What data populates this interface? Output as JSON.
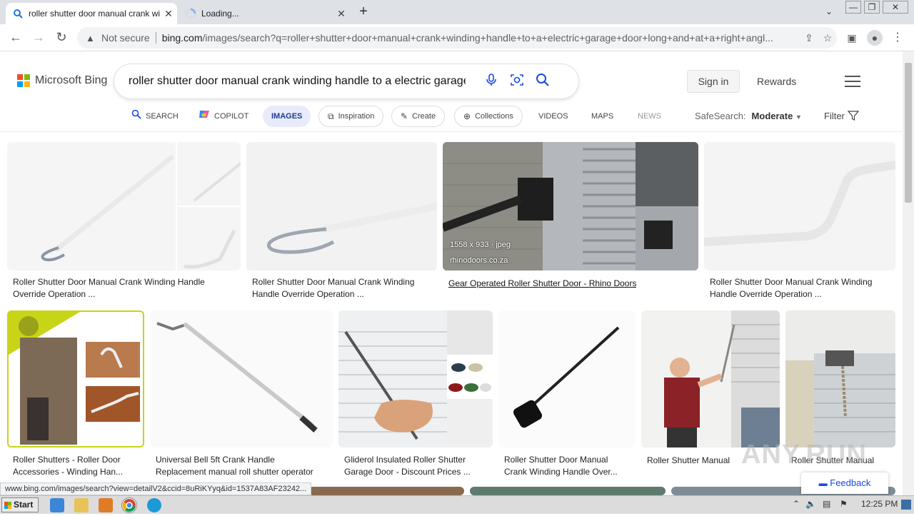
{
  "browser": {
    "tabs": [
      {
        "title": "roller shutter door manual crank winding handle",
        "close": "✕"
      },
      {
        "title": "Loading...",
        "close": "✕"
      }
    ],
    "new_tab": "+",
    "controls": {
      "dropdown": "⌄",
      "minimize": "—",
      "restore": "❐",
      "close": "✕"
    },
    "nav": {
      "back": "←",
      "forward": "→",
      "reload": "↻"
    },
    "omnibox": {
      "security": "Not secure",
      "url_host": "bing.com",
      "url_path": "/images/search?q=roller+shutter+door+manual+crank+winding+handle+to+a+electric+garage+door+long+and+at+a+right+angl..."
    }
  },
  "bing": {
    "brand": "Microsoft Bing",
    "brand_colors": [
      "#f25022",
      "#7fba00",
      "#00a4ef",
      "#ffb900"
    ],
    "query": "roller shutter door manual crank winding handle to a electric garage d",
    "sign_in": "Sign in",
    "rewards": "Rewards",
    "nav": {
      "search": "SEARCH",
      "copilot": "COPILOT",
      "images": "IMAGES",
      "inspiration": "Inspiration",
      "create": "Create",
      "collections": "Collections",
      "videos": "VIDEOS",
      "maps": "MAPS",
      "news": "NEWS"
    },
    "safesearch_label": "SafeSearch:",
    "safesearch_value": "Moderate",
    "filter": "Filter",
    "results_row1": [
      {
        "caption1": "Roller Shutter Door Manual Crank Winding Handle",
        "caption2": "Override Operation ..."
      },
      {
        "caption1": "Roller Shutter Door Manual Crank Winding",
        "caption2": "Handle Override Operation ..."
      },
      {
        "caption1": "Gear Operated Roller Shutter Door - Rhino Doors",
        "caption2": "",
        "meta": "1558 x 933 · jpeg",
        "source": "rhinodoors.co.za"
      },
      {
        "caption1": "Roller Shutter Door Manual Crank Winding",
        "caption2": "Handle Override Operation ..."
      }
    ],
    "results_row2": [
      {
        "caption1": "Roller Shutters - Roller Door",
        "caption2": "Accessories - Winding Han..."
      },
      {
        "caption1": "Universal Bell 5ft Crank Handle",
        "caption2": "Replacement manual roll shutter operator"
      },
      {
        "caption1": "Gliderol Insulated Roller Shutter",
        "caption2": "Garage Door - Discount Prices ..."
      },
      {
        "caption1": "Roller Shutter Door Manual",
        "caption2": "Crank Winding Handle Over..."
      },
      {
        "caption1": "Roller Shutter Manual",
        "caption2": ""
      },
      {
        "caption1": "Roller Shutter Manual",
        "caption2": ""
      }
    ],
    "feedback": "Feedback"
  },
  "status_url": "www.bing.com/images/search?view=detailV2&ccid=8uRiKYyq&id=1537A83AF23242...",
  "watermark": "ANY.RUN",
  "taskbar": {
    "start": "Start",
    "time": "12:25 PM"
  }
}
